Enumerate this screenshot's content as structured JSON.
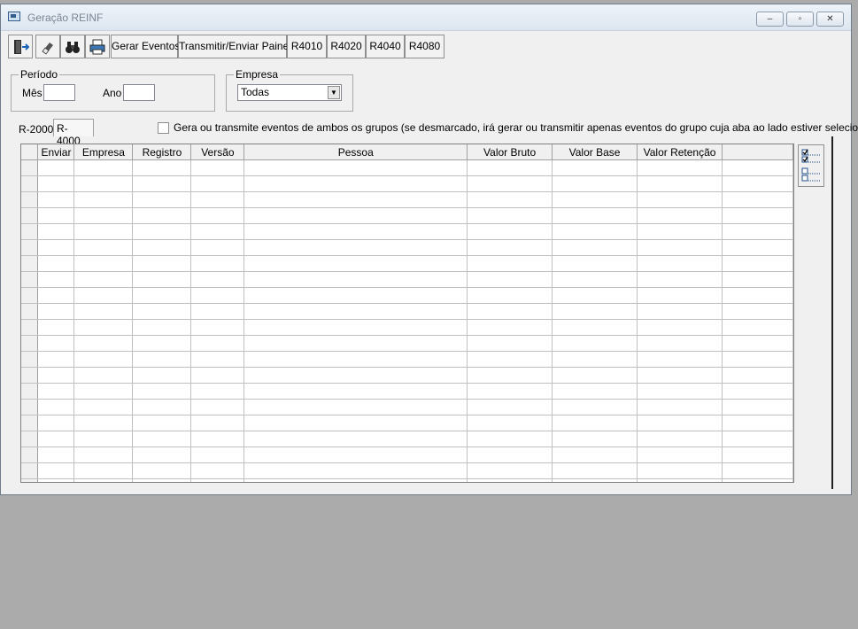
{
  "window": {
    "title": "Geração REINF",
    "controls": {
      "minimize": "–",
      "restore": "▫",
      "close": "✕"
    }
  },
  "toolbar": {
    "icons": [
      "exit-door-icon",
      "eraser-icon",
      "binoculars-icon",
      "printer-icon"
    ],
    "gerar_eventos": "Gerar Eventos",
    "transmitir": "Transmitir/Enviar Painel",
    "r4010": "R4010",
    "r4020": "R4020",
    "r4040": "R4040",
    "r4080": "R4080"
  },
  "periodo": {
    "legend": "Período",
    "mes_label": "Mês",
    "mes_value": "",
    "ano_label": "Ano",
    "ano_value": ""
  },
  "empresa": {
    "legend": "Empresa",
    "selected": "Todas"
  },
  "tabs": [
    "R-2000",
    "R-4000"
  ],
  "active_tab": "R-4000",
  "checkbox": {
    "checked": false,
    "label": "Gera ou transmite eventos de ambos os grupos (se desmarcado, irá gerar ou transmitir apenas eventos do grupo cuja aba ao lado estiver selecionada)"
  },
  "grid": {
    "columns": [
      "Enviar",
      "Empresa",
      "Registro",
      "Versão",
      "Pessoa",
      "Valor Bruto",
      "Valor Base",
      "Valor Retenção"
    ],
    "rows": []
  },
  "side_buttons": [
    "check-all-icon",
    "uncheck-all-icon"
  ]
}
